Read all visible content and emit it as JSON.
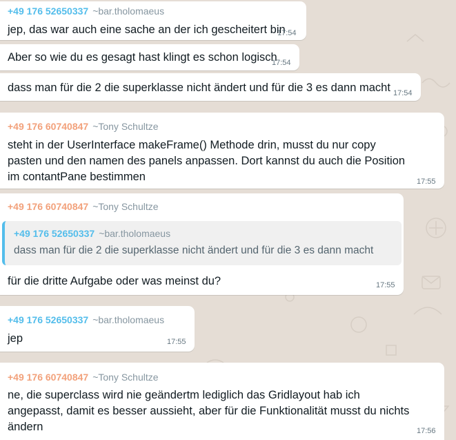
{
  "colors": {
    "chat_background": "#e5ddd5",
    "bubble": "#ffffff",
    "sender_blue": "#53bdeb",
    "sender_orange": "#f2a17b",
    "quote_bar": "#53bdeb"
  },
  "messages": [
    {
      "sender_phone": "+49 176 52650337",
      "sender_nick": "~bar.tholomaeus",
      "text": "jep, das war auch eine sache an der ich gescheitert bin",
      "time": "17:54"
    },
    {
      "text": "Aber so wie du es gesagt hast klingt es schon logisch",
      "time": "17:54"
    },
    {
      "text": "dass man für die 2 die superklasse nicht ändert und für die 3 es dann macht",
      "time": "17:54"
    },
    {
      "sender_phone": "+49 176 60740847",
      "sender_nick": "~Tony Schultze",
      "lines": [
        "steht in der UserInterface makeFrame() Methode drin, musst du nur copy",
        "pasten und den namen des panels anpassen. Dort kannst du auch die Position",
        "im contantPane bestimmen"
      ],
      "time": "17:55"
    },
    {
      "sender_phone": "+49 176 60740847",
      "sender_nick": "~Tony Schultze",
      "quote": {
        "sender_phone": "+49 176 52650337",
        "sender_nick": "~bar.tholomaeus",
        "text": "dass man für die 2 die superklasse nicht ändert und für die 3 es dann macht"
      },
      "text": "für die dritte Aufgabe oder was meinst du?",
      "time": "17:55"
    },
    {
      "sender_phone": "+49 176 52650337",
      "sender_nick": "~bar.tholomaeus",
      "text": "jep",
      "time": "17:55"
    },
    {
      "sender_phone": "+49 176 60740847",
      "sender_nick": "~Tony Schultze",
      "lines": [
        "ne, die superclass wird nie geändertm lediglich das Gridlayout hab ich",
        "angepasst, damit es besser aussieht, aber für die Funktionalität musst du nichts",
        "ändern"
      ],
      "time": "17:56"
    }
  ]
}
